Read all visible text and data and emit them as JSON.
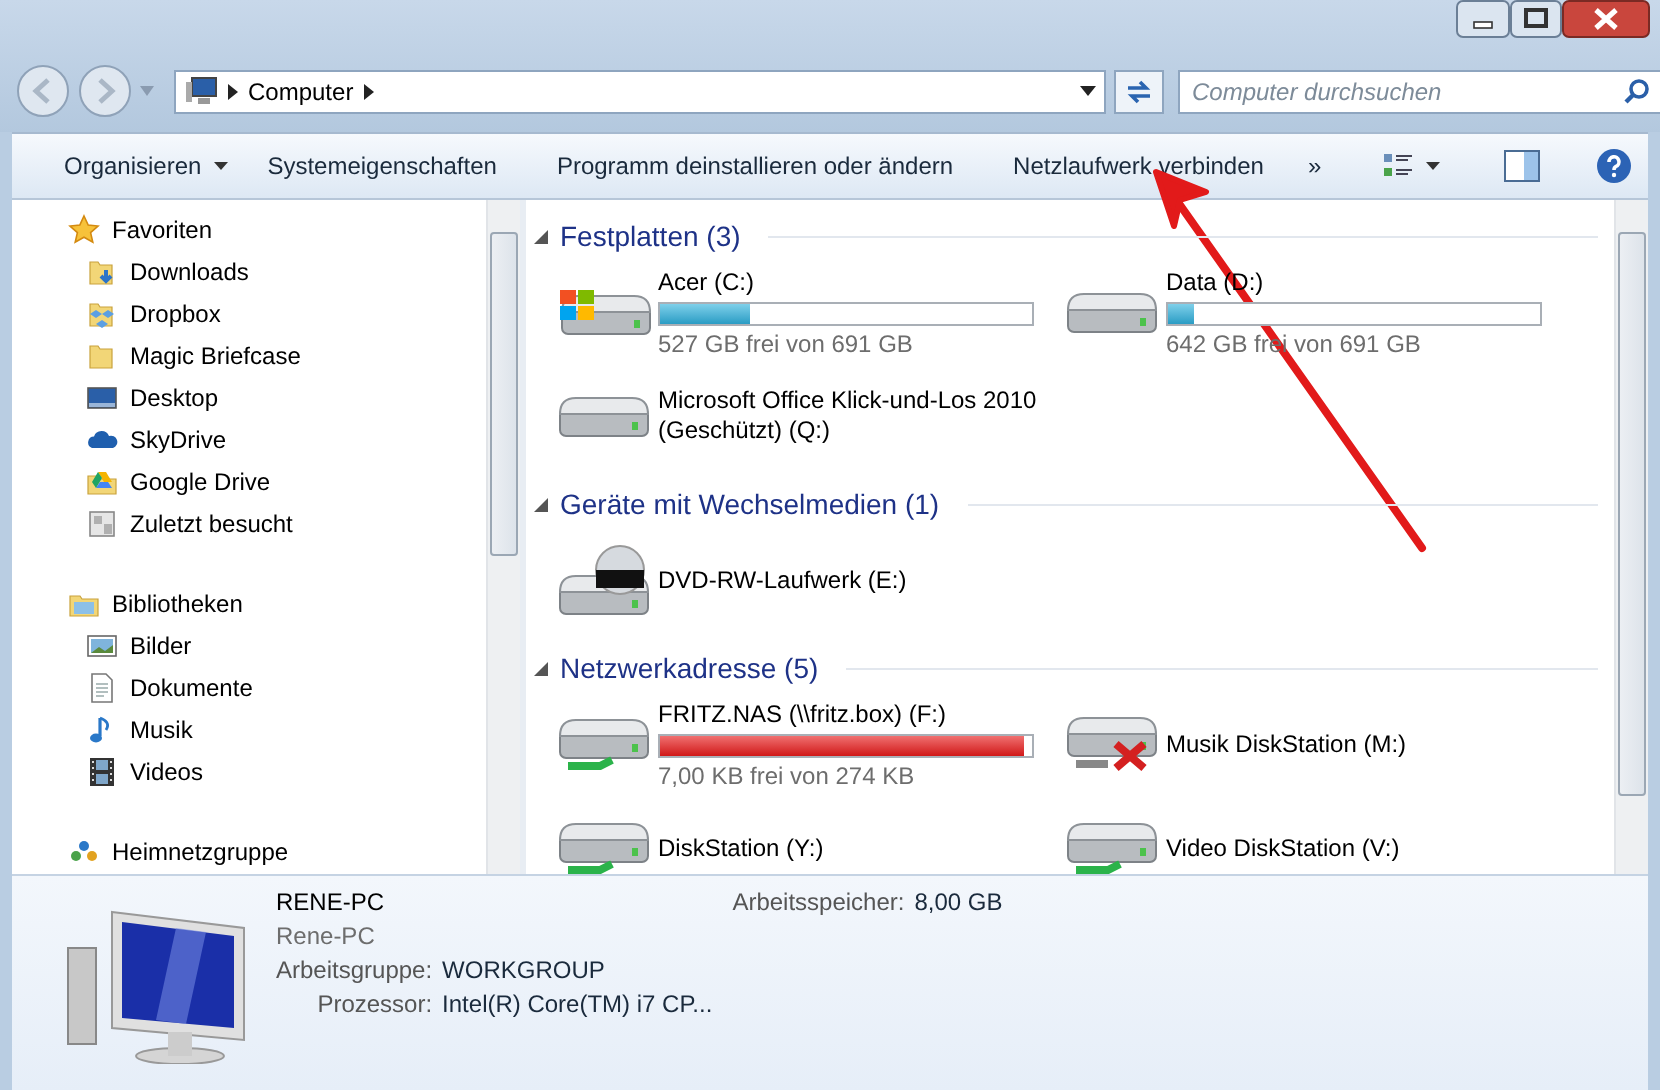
{
  "address": {
    "path": [
      "Computer"
    ]
  },
  "search": {
    "placeholder": "Computer durchsuchen"
  },
  "toolbar": {
    "items": [
      {
        "label": "Organisieren",
        "dropdown": true
      },
      {
        "label": "Systemeigenschaften",
        "dropdown": false
      },
      {
        "label": "Programm deinstallieren oder ändern",
        "dropdown": false
      },
      {
        "label": "Netzlaufwerk verbinden",
        "dropdown": false
      }
    ],
    "more": "»"
  },
  "navigation": [
    {
      "label": "Favoriten",
      "kind": "star",
      "children": [
        {
          "label": "Downloads",
          "kind": "downloads"
        },
        {
          "label": "Dropbox",
          "kind": "dropbox"
        },
        {
          "label": "Magic Briefcase",
          "kind": "folder"
        },
        {
          "label": "Desktop",
          "kind": "desktop"
        },
        {
          "label": "SkyDrive",
          "kind": "cloud"
        },
        {
          "label": "Google Drive",
          "kind": "gdrive"
        },
        {
          "label": "Zuletzt besucht",
          "kind": "recent"
        }
      ]
    },
    {
      "label": "Bibliotheken",
      "kind": "library",
      "children": [
        {
          "label": "Bilder",
          "kind": "pictures"
        },
        {
          "label": "Dokumente",
          "kind": "documents"
        },
        {
          "label": "Musik",
          "kind": "music"
        },
        {
          "label": "Videos",
          "kind": "videos"
        }
      ]
    },
    {
      "label": "Heimnetzgruppe",
      "kind": "homegroup"
    }
  ],
  "sections": [
    {
      "title": "Festplatten (3)",
      "expanded": true,
      "drives": [
        {
          "name": "Acer (C:)",
          "kind": "system",
          "level": 0.24,
          "space": "527 GB frei von 691 GB"
        },
        {
          "name": "Data (D:)",
          "kind": "disk",
          "level": 0.07,
          "space": "642 GB frei von 691 GB"
        },
        {
          "name": "Microsoft Office Klick-und-Los 2010 (Geschützt) (Q:)",
          "kind": "disk"
        }
      ]
    },
    {
      "title": "Geräte mit Wechselmedien (1)",
      "expanded": true,
      "drives": [
        {
          "name": "DVD-RW-Laufwerk (E:)",
          "kind": "dvd"
        }
      ]
    },
    {
      "title": "Netzwerkadresse (5)",
      "expanded": true,
      "drives": [
        {
          "name": "FRITZ.NAS (\\\\fritz.box) (F:)",
          "kind": "network",
          "level": 0.98,
          "space": "7,00 KB frei von 274 KB"
        },
        {
          "name": "Musik DiskStation (M:)",
          "kind": "offline"
        },
        {
          "name": "DiskStation (Y:)",
          "kind": "network"
        },
        {
          "name": "Video DiskStation (V:)",
          "kind": "network"
        }
      ]
    }
  ],
  "details": {
    "name": "RENE-PC",
    "subtitle": "Rene-PC",
    "fields": [
      {
        "label": "Arbeitsgruppe:",
        "value": "WORKGROUP"
      },
      {
        "label": "Prozessor:",
        "value": "Intel(R) Core(TM) i7 CP..."
      }
    ],
    "side_fields": [
      {
        "label": "Arbeitsspeicher:",
        "value": "8,00 GB"
      }
    ]
  }
}
